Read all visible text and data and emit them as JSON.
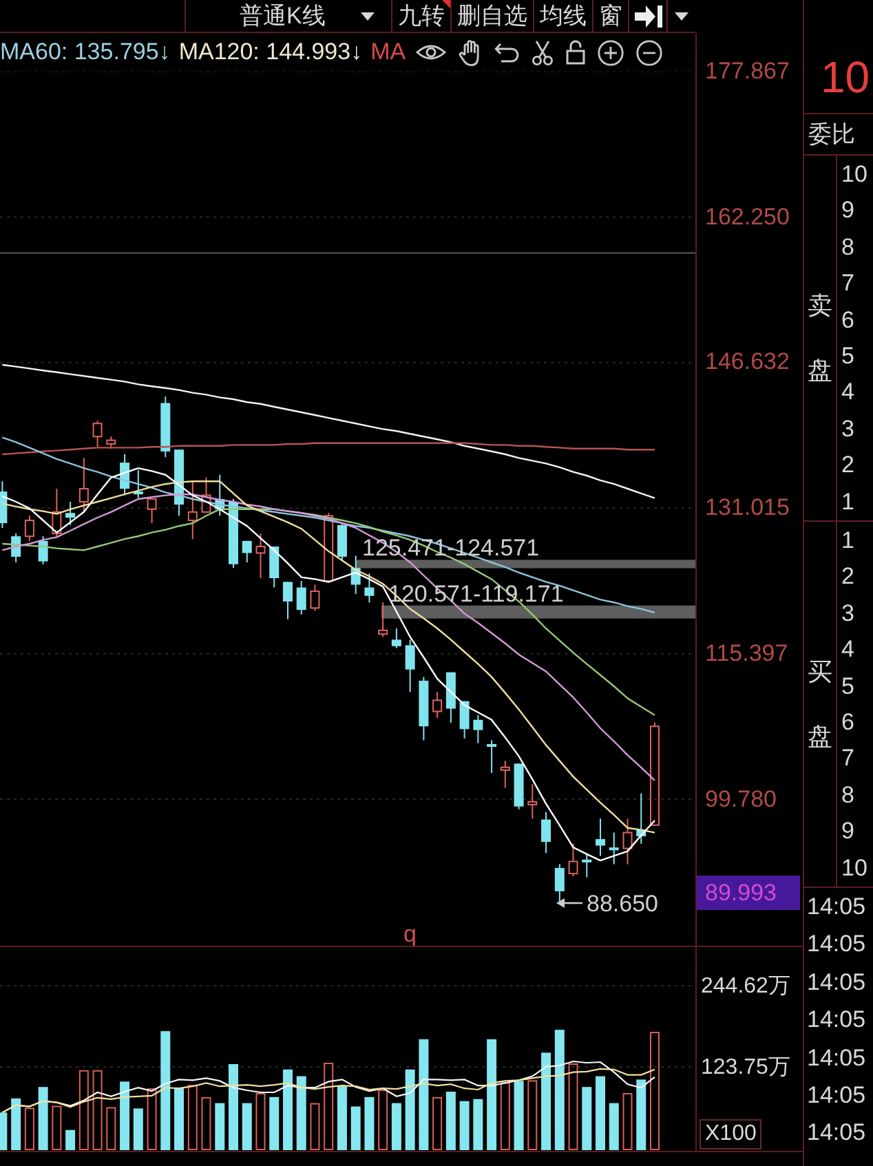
{
  "toolbar": {
    "chart_type": "普通K线",
    "buttons": [
      {
        "label": "九转",
        "marked": true
      },
      {
        "label": "删自选",
        "marked": false
      },
      {
        "label": "均线",
        "marked": false
      },
      {
        "label": "窗",
        "marked": false
      }
    ]
  },
  "indicators": [
    {
      "label": "MA60: 135.795↓",
      "color": "#9ccfe0"
    },
    {
      "label": "MA120: 144.993↓",
      "color": "#efe7cf"
    },
    {
      "label": "MA",
      "color": "#d84a48"
    }
  ],
  "price_chart": {
    "chart_data": {
      "type": "candlestick",
      "grid": true,
      "ylim": [
        83.98,
        177.867
      ],
      "yticks": [
        {
          "value": 177.867,
          "label": "177.867"
        },
        {
          "value": 162.25,
          "label": "162.250"
        },
        {
          "value": 146.632,
          "label": "146.632"
        },
        {
          "value": 131.015,
          "label": "131.015"
        },
        {
          "value": 115.397,
          "label": "115.397"
        },
        {
          "value": 99.78,
          "label": "99.780"
        }
      ],
      "ohlc": [
        [
          132.8,
          133.9,
          128.9,
          129.4
        ],
        [
          128.0,
          128.3,
          125.2,
          125.8
        ],
        [
          128.0,
          130.2,
          127.5,
          129.7
        ],
        [
          127.5,
          128.0,
          125.0,
          125.3
        ],
        [
          128.3,
          133.1,
          128.0,
          130.6
        ],
        [
          130.5,
          131.7,
          129.2,
          130.0
        ],
        [
          131.7,
          136.4,
          130.5,
          133.1
        ],
        [
          138.7,
          140.4,
          137.6,
          140.1
        ],
        [
          137.9,
          138.7,
          137.4,
          138.3
        ],
        [
          135.9,
          136.8,
          132.4,
          133.1
        ],
        [
          132.8,
          135.1,
          132.1,
          132.5
        ],
        [
          130.9,
          132.0,
          129.4,
          132.0
        ],
        [
          142.3,
          143.0,
          136.5,
          137.1
        ],
        [
          137.3,
          137.3,
          130.2,
          131.4
        ],
        [
          129.7,
          133.9,
          127.7,
          130.6
        ],
        [
          130.6,
          134.3,
          130.5,
          132.4
        ],
        [
          132.0,
          134.6,
          130.2,
          130.9
        ],
        [
          131.7,
          132.0,
          124.6,
          125.0
        ],
        [
          127.5,
          127.5,
          125.2,
          126.2
        ],
        [
          126.2,
          128.3,
          123.5,
          126.9
        ],
        [
          126.9,
          126.9,
          122.5,
          123.5
        ],
        [
          123.1,
          123.1,
          119.1,
          121.0
        ],
        [
          122.5,
          123.2,
          119.6,
          120.1
        ],
        [
          120.3,
          122.8,
          120.0,
          122.1
        ],
        [
          123.2,
          130.5,
          123.0,
          130.2
        ],
        [
          129.2,
          129.4,
          125.3,
          125.8
        ],
        [
          124.6,
          125.9,
          121.8,
          122.8
        ],
        [
          122.5,
          124.0,
          120.9,
          121.6
        ],
        [
          117.5,
          120.9,
          117.2,
          117.9
        ],
        [
          116.9,
          118.1,
          116.0,
          116.2
        ],
        [
          116.3,
          116.9,
          111.3,
          113.7
        ],
        [
          112.5,
          112.9,
          106.1,
          107.6
        ],
        [
          109.2,
          111.3,
          108.5,
          110.4
        ],
        [
          113.4,
          113.4,
          108.0,
          109.5
        ],
        [
          110.3,
          110.3,
          106.3,
          107.3
        ],
        [
          108.3,
          108.8,
          105.8,
          107.2
        ],
        [
          105.7,
          106.1,
          102.6,
          105.4
        ],
        [
          102.9,
          103.9,
          101.0,
          103.2
        ],
        [
          103.6,
          103.6,
          98.7,
          99.0
        ],
        [
          99.2,
          101.4,
          97.7,
          99.5
        ],
        [
          97.6,
          98.4,
          94.0,
          95.2
        ],
        [
          92.4,
          92.8,
          88.65,
          89.9
        ],
        [
          91.8,
          95.0,
          91.5,
          93.1
        ],
        [
          93.3,
          94.0,
          91.4,
          93.0
        ],
        [
          95.5,
          97.7,
          93.7,
          94.8
        ],
        [
          94.6,
          96.2,
          92.8,
          94.3
        ],
        [
          94.5,
          97.7,
          92.8,
          96.2
        ],
        [
          96.5,
          100.4,
          95.0,
          95.8
        ],
        [
          97.0,
          108.0,
          97.0,
          107.6
        ]
      ],
      "series": [
        {
          "type": "line",
          "color": "#f4f4f4",
          "values": [
            146.4,
            146.2,
            146.0,
            145.8,
            145.6,
            145.4,
            145.2,
            145.0,
            144.8,
            144.6,
            144.3,
            144.1,
            143.9,
            143.7,
            143.4,
            143.2,
            142.9,
            142.7,
            142.4,
            142.2,
            141.9,
            141.6,
            141.3,
            141.0,
            140.7,
            140.4,
            140.1,
            139.8,
            139.5,
            139.3,
            139.0,
            138.7,
            138.4,
            138.1,
            137.7,
            137.4,
            137.1,
            136.8,
            136.4,
            136.1,
            135.8,
            135.4,
            134.9,
            134.5,
            134.0,
            133.6,
            133.1,
            132.6,
            132.1
          ]
        },
        {
          "type": "line",
          "color": "#b85450",
          "values": [
            136.8,
            136.9,
            137.0,
            137.1,
            137.2,
            137.3,
            137.4,
            137.5,
            137.5,
            137.5,
            137.5,
            137.6,
            137.6,
            137.7,
            137.7,
            137.7,
            137.7,
            137.8,
            137.8,
            137.8,
            137.8,
            137.9,
            137.9,
            138.0,
            138.0,
            138.0,
            138.0,
            138.0,
            138.0,
            138.0,
            138.0,
            138.0,
            138.0,
            138.0,
            138.0,
            137.9,
            137.8,
            137.8,
            137.7,
            137.7,
            137.6,
            137.5,
            137.4,
            137.4,
            137.4,
            137.4,
            137.3,
            137.3,
            137.3
          ]
        },
        {
          "type": "line",
          "color": "#8cc4dc",
          "values": [
            138.6,
            138.1,
            137.5,
            136.9,
            136.3,
            135.8,
            135.3,
            134.9,
            134.4,
            134.0,
            133.6,
            133.2,
            132.7,
            132.4,
            132.0,
            131.7,
            131.4,
            131.2,
            131.0,
            130.8,
            130.6,
            130.4,
            130.2,
            130.0,
            129.7,
            129.4,
            129.1,
            128.9,
            128.6,
            128.3,
            128.0,
            127.6,
            127.2,
            126.7,
            126.2,
            125.7,
            125.2,
            124.7,
            124.1,
            123.6,
            123.1,
            122.7,
            122.2,
            121.7,
            121.2,
            120.9,
            120.5,
            120.2,
            119.8
          ]
        },
        {
          "type": "line",
          "color": "#96c878",
          "values": [
            127.2,
            127.1,
            127.0,
            126.9,
            126.7,
            126.6,
            126.5,
            126.9,
            127.3,
            127.7,
            128.0,
            128.4,
            128.7,
            129.1,
            129.4,
            130.2,
            130.9,
            130.9,
            130.9,
            130.9,
            130.9,
            130.7,
            130.5,
            130.3,
            130.0,
            129.7,
            129.4,
            129.0,
            128.5,
            128.1,
            127.6,
            127.0,
            126.3,
            125.7,
            125.0,
            124.2,
            123.4,
            122.2,
            121.0,
            119.6,
            118.1,
            116.8,
            115.5,
            114.3,
            113.1,
            111.9,
            110.6,
            109.7,
            108.8
          ]
        },
        {
          "type": "line",
          "color": "#d49ad8",
          "values": [
            126.5,
            126.9,
            127.2,
            127.6,
            127.9,
            128.6,
            129.3,
            130.0,
            130.6,
            131.3,
            132.0,
            132.2,
            132.4,
            132.5,
            132.5,
            132.2,
            131.9,
            131.7,
            131.4,
            131.2,
            130.9,
            130.7,
            130.5,
            130.2,
            129.9,
            129.4,
            128.9,
            128.1,
            127.3,
            126.3,
            125.2,
            123.8,
            122.4,
            121.1,
            119.7,
            118.7,
            117.6,
            116.5,
            115.3,
            114.4,
            113.5,
            112.1,
            110.7,
            109.1,
            107.4,
            106.0,
            104.5,
            103.2,
            101.8
          ]
        },
        {
          "type": "line",
          "color": "#f1df9c",
          "values": [
            131.5,
            131.2,
            130.9,
            130.7,
            130.4,
            130.9,
            131.3,
            131.7,
            132.1,
            132.5,
            132.9,
            133.3,
            133.6,
            133.8,
            133.9,
            133.9,
            133.9,
            132.6,
            131.3,
            130.7,
            130.1,
            129.5,
            128.8,
            127.6,
            126.4,
            125.4,
            124.4,
            123.7,
            122.9,
            121.6,
            120.2,
            119.2,
            118.1,
            116.9,
            115.6,
            114.3,
            112.9,
            111.2,
            109.4,
            107.5,
            105.6,
            103.9,
            102.2,
            100.8,
            99.4,
            98.1,
            96.7,
            96.5,
            96.2
          ]
        },
        {
          "type": "line",
          "color": "#ffffff",
          "values": [
            132.3,
            131.7,
            131.0,
            129.7,
            128.4,
            129.5,
            130.6,
            132.5,
            134.3,
            134.8,
            135.3,
            135.0,
            134.6,
            133.5,
            132.4,
            131.7,
            130.9,
            130.0,
            129.1,
            127.8,
            126.5,
            125.1,
            123.6,
            123.4,
            123.1,
            123.6,
            124.1,
            123.4,
            122.6,
            119.9,
            117.2,
            115.0,
            112.7,
            111.3,
            109.9,
            109.1,
            108.3,
            106.4,
            104.4,
            101.9,
            99.3,
            97.0,
            94.6,
            93.9,
            93.2,
            93.7,
            94.2,
            95.9,
            97.5
          ]
        }
      ],
      "ref_lines": [
        {
          "axis": "y",
          "value": 158.4
        }
      ],
      "bands": [
        {
          "axis": "y",
          "from": 124.571,
          "to": 125.471,
          "label": "125.471-124.571"
        },
        {
          "axis": "y",
          "from": 119.171,
          "to": 120.571,
          "label": "120.571-119.171"
        }
      ]
    },
    "current_price": "89.993",
    "low_label": "88.650",
    "axis_mark": "q"
  },
  "volume_chart": {
    "unit": "X100",
    "chart_data": {
      "type": "bar",
      "grid": true,
      "ylim": [
        0,
        303
      ],
      "yticks": [
        {
          "value": 244.62,
          "label": "244.62万"
        },
        {
          "value": 123.75,
          "label": "123.75万"
        }
      ],
      "series": [
        {
          "values": [
            56,
            77,
            63,
            94,
            66,
            30,
            119,
            119,
            64,
            102,
            62,
            92,
            177,
            92,
            97,
            79,
            70,
            128,
            70,
            85,
            79,
            120,
            110,
            70,
            130,
            95,
            65,
            79,
            90,
            70,
            120,
            165,
            79,
            87,
            73,
            76,
            165,
            101,
            103,
            104,
            145,
            179,
            129,
            94,
            110,
            70,
            85,
            105,
            176
          ],
          "colors": [
            "#86e6f0",
            "#86e6f0",
            "#d8605a",
            "#86e6f0",
            "#d8605a",
            "#86e6f0",
            "#d8605a",
            "#d8605a",
            "#d8605a",
            "#86e6f0",
            "#86e6f0",
            "#d8605a",
            "#86e6f0",
            "#86e6f0",
            "#d8605a",
            "#d8605a",
            "#86e6f0",
            "#86e6f0",
            "#86e6f0",
            "#d8605a",
            "#86e6f0",
            "#86e6f0",
            "#86e6f0",
            "#d8605a",
            "#d8605a",
            "#86e6f0",
            "#86e6f0",
            "#86e6f0",
            "#d8605a",
            "#86e6f0",
            "#86e6f0",
            "#86e6f0",
            "#d8605a",
            "#86e6f0",
            "#86e6f0",
            "#86e6f0",
            "#86e6f0",
            "#d8605a",
            "#86e6f0",
            "#d8605a",
            "#86e6f0",
            "#86e6f0",
            "#d8605a",
            "#86e6f0",
            "#86e6f0",
            "#86e6f0",
            "#d8605a",
            "#86e6f0",
            "#d8605a"
          ]
        },
        {
          "type": "line",
          "color": "#f5f5f5",
          "values": [
            56,
            67,
            65,
            73,
            71,
            66,
            74,
            86,
            80,
            87,
            93,
            88,
            99,
            105,
            104,
            107,
            103,
            93,
            89,
            86,
            86,
            96,
            93,
            93,
            102,
            105,
            94,
            88,
            92,
            80,
            85,
            105,
            105,
            104,
            105,
            96,
            96,
            100,
            104,
            110,
            124,
            126,
            132,
            130,
            131,
            116,
            98,
            93,
            109
          ]
        },
        {
          "type": "line",
          "color": "#f1df9c",
          "values": [
            56,
            67,
            65,
            73,
            71,
            64,
            72,
            78,
            76,
            79,
            80,
            81,
            93,
            92,
            95,
            100,
            95,
            96,
            97,
            95,
            97,
            100,
            93,
            91,
            94,
            96,
            95,
            90,
            92,
            91,
            95,
            99,
            96,
            98,
            92,
            90,
            100,
            103,
            104,
            107,
            110,
            111,
            116,
            117,
            121,
            120,
            112,
            112,
            120
          ]
        }
      ]
    }
  },
  "order_book": {
    "header_number": "10",
    "ratio_label": "委比",
    "ask": {
      "label": "卖盘",
      "levels": [
        "10",
        "9",
        "8",
        "7",
        "6",
        "5",
        "4",
        "3",
        "2",
        "1"
      ]
    },
    "bid": {
      "label": "买盘",
      "levels": [
        "1",
        "2",
        "3",
        "4",
        "5",
        "6",
        "7",
        "8",
        "9",
        "10"
      ]
    }
  },
  "trade_times": [
    "14:05",
    "14:05",
    "14:05",
    "14:05",
    "14:05",
    "14:05",
    "14:05"
  ]
}
